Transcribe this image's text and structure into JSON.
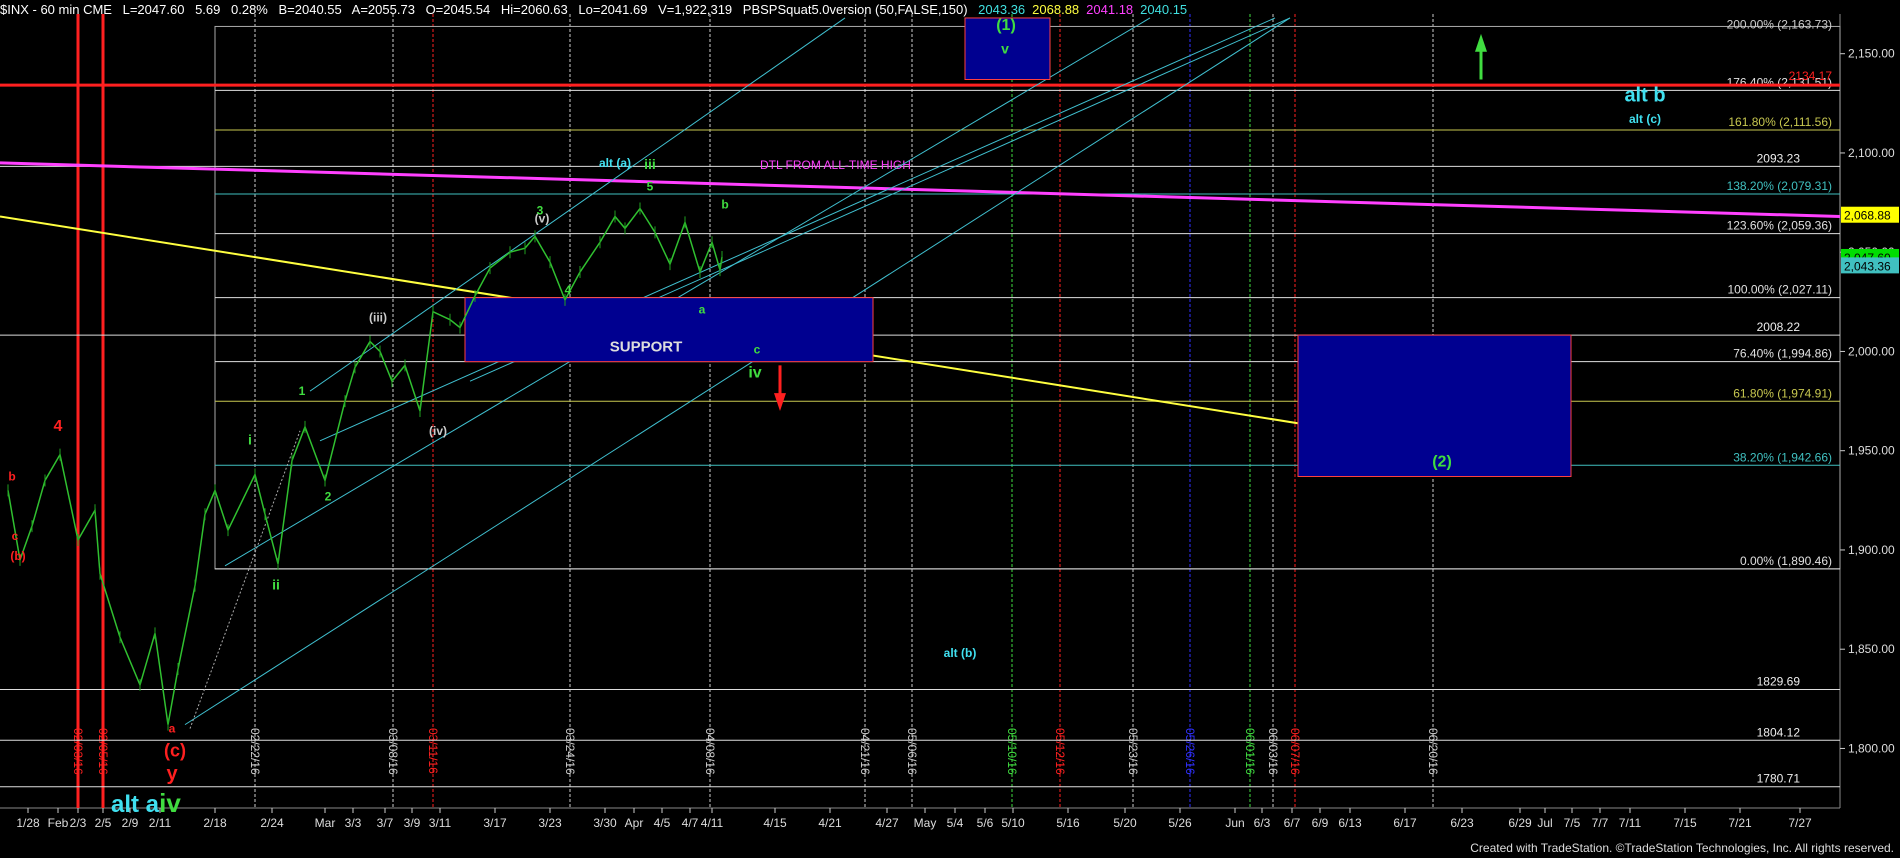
{
  "header": {
    "symbol": "$INX - 60 min  CME",
    "last": "L=2047.60",
    "chg": "5.69",
    "pct": "0.28%",
    "bid": "B=2040.55",
    "ask": "A=2055.73",
    "open": "O=2045.54",
    "high": "Hi=2060.63",
    "low": "Lo=2041.69",
    "volume": "V=1,922,319",
    "indicator": "PBSPSquat5.0version (50,FALSE,150)",
    "ind_vals": [
      {
        "text": "2043.36",
        "color": "#40e0e0"
      },
      {
        "text": "2068.88",
        "color": "#ffff40"
      },
      {
        "text": "2041.18",
        "color": "#ff40ff"
      },
      {
        "text": "2040.15",
        "color": "#40e0e0"
      }
    ]
  },
  "footer": "Created with TradeStation. ©TradeStation Technologies, Inc. All rights reserved.",
  "chart_data": {
    "type": "line",
    "title": "$INX - 60 min",
    "y_ticks": [
      "2,150.00",
      "2,100.00",
      "2,050.00",
      "2,000.00",
      "1,950.00",
      "1,900.00",
      "1,850.00",
      "1,800.00"
    ],
    "ylim": [
      1770,
      2170
    ],
    "x_ticks": [
      "1/28",
      "Feb",
      "2/3",
      "2/5",
      "2/9",
      "2/11",
      "2/18",
      "2/24",
      "Mar",
      "3/3",
      "3/7",
      "3/9",
      "3/11",
      "3/17",
      "3/23",
      "3/30",
      "Apr",
      "4/5",
      "4/7",
      "4/11",
      "4/15",
      "4/21",
      "4/27",
      "May",
      "5/4",
      "5/6",
      "5/10",
      "5/16",
      "5/20",
      "5/26",
      "Jun",
      "6/3",
      "6/7",
      "6/9",
      "6/13",
      "6/17",
      "6/23",
      "6/29",
      "Jul",
      "7/5",
      "7/7",
      "7/11",
      "7/15",
      "7/21",
      "7/27"
    ],
    "price_badges": [
      {
        "text": "2,068.88",
        "value": 2068.88,
        "bg": "#ffff00",
        "fg": "#000"
      },
      {
        "text": "2,047.60",
        "value": 2047.6,
        "bg": "#00dd00",
        "fg": "#000"
      },
      {
        "text": "2,043.36",
        "value": 2043.36,
        "bg": "#40c0c0",
        "fg": "#000"
      }
    ],
    "fib_levels": [
      {
        "label": "176.40% (2,131.51)",
        "value": 2131.51,
        "color": "#e0e0e0"
      },
      {
        "label": "161.80% (2,111.56)",
        "value": 2111.56,
        "color": "#c8c850"
      },
      {
        "label": "138.20% (2,079.31)",
        "value": 2079.31,
        "color": "#40c0c0"
      },
      {
        "label": "123.60% (2,059.36)",
        "value": 2059.36,
        "color": "#e0e0e0"
      },
      {
        "label": "100.00% (2,027.11)",
        "value": 2027.11,
        "color": "#e0e0e0"
      },
      {
        "label": "76.40% (1,994.86)",
        "value": 1994.86,
        "color": "#e0e0e0"
      },
      {
        "label": "61.80% (1,974.91)",
        "value": 1974.91,
        "color": "#c8c850"
      },
      {
        "label": "38.20% (1,942.66)",
        "value": 1942.66,
        "color": "#40c0c0"
      },
      {
        "label": "0.00% (1,890.46)",
        "value": 1890.46,
        "color": "#e0e0e0"
      }
    ],
    "h_levels": [
      {
        "label": "2093.23",
        "value": 2093.23
      },
      {
        "label": "2008.22",
        "value": 2008.22
      },
      {
        "label": "1829.69",
        "value": 1829.69
      },
      {
        "label": "1804.12",
        "value": 1804.12
      },
      {
        "label": "1780.71",
        "value": 1780.71
      }
    ],
    "top_partial_label": "200.00% (2,163.73)",
    "red_level": {
      "label": "2134.17",
      "value": 2134.17
    },
    "vline_dates": [
      {
        "label": "02/03/16",
        "color": "#ff2020"
      },
      {
        "label": "02/05/16",
        "color": "#ff2020"
      },
      {
        "label": "02/22/16",
        "color": "#cccccc"
      },
      {
        "label": "03/08/16",
        "color": "#cccccc"
      },
      {
        "label": "03/11/16",
        "color": "#ff2020"
      },
      {
        "label": "03/24/16",
        "color": "#cccccc"
      },
      {
        "label": "04/08/16",
        "color": "#cccccc"
      },
      {
        "label": "04/21/16",
        "color": "#cccccc"
      },
      {
        "label": "05/06/16",
        "color": "#cccccc"
      },
      {
        "label": "05/10/16",
        "color": "#40dd40"
      },
      {
        "label": "05/12/16",
        "color": "#ff2020"
      },
      {
        "label": "05/23/16",
        "color": "#cccccc"
      },
      {
        "label": "05/26/16",
        "color": "#3030ff"
      },
      {
        "label": "06/01/16",
        "color": "#40dd40"
      },
      {
        "label": "06/03/16",
        "color": "#cccccc"
      },
      {
        "label": "06/07/16",
        "color": "#ff2020"
      },
      {
        "label": "06/20/16",
        "color": "#cccccc"
      }
    ],
    "wave_labels": [
      {
        "text": "4",
        "color": "#ff2020"
      },
      {
        "text": "b",
        "color": "#ff2020"
      },
      {
        "text": "c",
        "color": "#ff2020"
      },
      {
        "text": "(b)",
        "color": "#ff2020"
      },
      {
        "text": "a",
        "color": "#ff2020"
      },
      {
        "text": "(c)",
        "color": "#ff2020"
      },
      {
        "text": "y",
        "color": "#ff2020"
      },
      {
        "text": "alt a",
        "color": "#40e0f0"
      },
      {
        "text": "iv",
        "color": "#40dd40"
      },
      {
        "text": "i",
        "color": "#40dd40"
      },
      {
        "text": "ii",
        "color": "#40dd40"
      },
      {
        "text": "1",
        "color": "#40dd40"
      },
      {
        "text": "2",
        "color": "#40dd40"
      },
      {
        "text": "(iii)",
        "color": "#cccccc"
      },
      {
        "text": "(iv)",
        "color": "#cccccc"
      },
      {
        "text": "(v)",
        "color": "#cccccc"
      },
      {
        "text": "3",
        "color": "#40dd40"
      },
      {
        "text": "4",
        "color": "#40dd40"
      },
      {
        "text": "5",
        "color": "#40dd40"
      },
      {
        "text": "iii",
        "color": "#40dd40"
      },
      {
        "text": "alt (a)",
        "color": "#40e0f0"
      },
      {
        "text": "a",
        "color": "#40dd40"
      },
      {
        "text": "b",
        "color": "#40dd40"
      },
      {
        "text": "c",
        "color": "#40dd40"
      },
      {
        "text": "iv",
        "color": "#40dd40"
      },
      {
        "text": "(1)",
        "color": "#40dd40"
      },
      {
        "text": "v",
        "color": "#40dd40"
      },
      {
        "text": "(2)",
        "color": "#40dd40"
      },
      {
        "text": "alt b",
        "color": "#40e0f0"
      },
      {
        "text": "alt (c)",
        "color": "#40e0f0"
      },
      {
        "text": "alt (b)",
        "color": "#40e0f0"
      }
    ],
    "annotations": {
      "dtl": "DTL FROM ALL-TIME HIGH",
      "support": "SUPPORT"
    },
    "price_path": [
      {
        "d": "1/28",
        "v": 1930
      },
      {
        "d": "1/29",
        "v": 1895
      },
      {
        "d": "1/30",
        "v": 1912
      },
      {
        "d": "2/1",
        "v": 1935
      },
      {
        "d": "2/2",
        "v": 1948
      },
      {
        "d": "2/3",
        "v": 1905
      },
      {
        "d": "2/4",
        "v": 1920
      },
      {
        "d": "2/5",
        "v": 1888
      },
      {
        "d": "2/8",
        "v": 1856
      },
      {
        "d": "2/9",
        "v": 1832
      },
      {
        "d": "2/10",
        "v": 1858
      },
      {
        "d": "2/11",
        "v": 1812
      },
      {
        "d": "2/12",
        "v": 1840
      },
      {
        "d": "2/16",
        "v": 1882
      },
      {
        "d": "2/17",
        "v": 1918
      },
      {
        "d": "2/18",
        "v": 1930
      },
      {
        "d": "2/19",
        "v": 1910
      },
      {
        "d": "2/22",
        "v": 1938
      },
      {
        "d": "2/23",
        "v": 1918
      },
      {
        "d": "2/24",
        "v": 1893
      },
      {
        "d": "2/25",
        "v": 1945
      },
      {
        "d": "2/26",
        "v": 1962
      },
      {
        "d": "2/29",
        "v": 1935
      },
      {
        "d": "3/1",
        "v": 1975
      },
      {
        "d": "3/3",
        "v": 1992
      },
      {
        "d": "3/4",
        "v": 2005
      },
      {
        "d": "3/7",
        "v": 2000
      },
      {
        "d": "3/8",
        "v": 1985
      },
      {
        "d": "3/9",
        "v": 1993
      },
      {
        "d": "3/10",
        "v": 1970
      },
      {
        "d": "3/11",
        "v": 2020
      },
      {
        "d": "3/14",
        "v": 2016
      },
      {
        "d": "3/15",
        "v": 2012
      },
      {
        "d": "3/16",
        "v": 2028
      },
      {
        "d": "3/17",
        "v": 2042
      },
      {
        "d": "3/18",
        "v": 2050
      },
      {
        "d": "3/21",
        "v": 2052
      },
      {
        "d": "3/22",
        "v": 2058
      },
      {
        "d": "3/23",
        "v": 2045
      },
      {
        "d": "3/24",
        "v": 2026
      },
      {
        "d": "3/28",
        "v": 2040
      },
      {
        "d": "3/29",
        "v": 2055
      },
      {
        "d": "3/30",
        "v": 2068
      },
      {
        "d": "3/31",
        "v": 2062
      },
      {
        "d": "4/1",
        "v": 2072
      },
      {
        "d": "4/4",
        "v": 2060
      },
      {
        "d": "4/5",
        "v": 2044
      },
      {
        "d": "4/6",
        "v": 2065
      },
      {
        "d": "4/7",
        "v": 2040
      },
      {
        "d": "4/8",
        "v": 2055
      },
      {
        "d": "4/11",
        "v": 2041
      },
      {
        "d": "4/11 close",
        "v": 2047.6
      }
    ]
  }
}
